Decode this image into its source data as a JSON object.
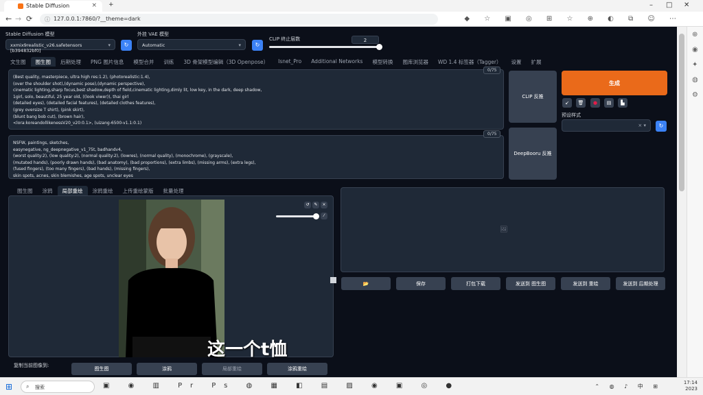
{
  "browser": {
    "tab_title": "Stable Diffusion",
    "new_tab": "+",
    "url": "127.0.0.1:7860/?__theme=dark",
    "back_icon": "←",
    "forward_icon": "→",
    "reload_icon": "⟳",
    "lock_icon": "ⓘ",
    "ext_icons": "◆ ☆ ▣ ◎ ⊞ ☆ ⊕ ◐ ⧉ ☺ ⋯",
    "tab_close": "×",
    "win_min": "–",
    "win_max": "□",
    "win_close": "✕",
    "chevron": "⌄"
  },
  "top": {
    "model_label": "Stable Diffusion 模型",
    "model_value": "xxmix9realistic_v26.safetensors [b394832bf0]",
    "vae_label": "外挂 VAE 模型",
    "vae_value": "Automatic",
    "clip_label": "CLIP 终止层数",
    "clip_value": "2",
    "clip_fraction": 1.0,
    "caret": "▾",
    "refresh_icon": "↻"
  },
  "main_tabs": [
    "文生图",
    "图生图",
    "后期处理",
    "PNG 图片信息",
    "模型合并",
    "训练",
    "3D 骨架模型编辑（3D Openpose）",
    "Isnet_Pro",
    "Additional Networks",
    "模型转换",
    "图库浏览器",
    "WD 1.4 标签器（Tagger）",
    "设置",
    "扩展"
  ],
  "main_active": 1,
  "prompt": {
    "counter": "0/75",
    "lines": [
      "(Best quality, masterpiece, ultra high res:1.2), (photorealistic:1.4),",
      "(over the shoulder shot),(dynamic pose),(dynamic perspective),",
      "cinematic lighting,sharp focus,best shadow,depth of field,cinematic lighting,dimly lit, low key, in the dark, deep shadow,",
      "1girl, solo, beautiful, 25 year old, ((look viwer)), thai girl",
      "(detailed eyes), (detailed facial features), (detailed clothes features),",
      "(grey oversize T shirt), (pink skirt),",
      "(blunt bang bob cut), (brown hair),",
      "<lora:koreandollikenessV20_v20:0.1>, (uizang-6500-v1.1:0.1)"
    ]
  },
  "negative": {
    "counter": "0/75",
    "lines": [
      "NSFW, paintings, sketches,",
      "easynegative, ng_deepnegative_v1_75t, badhandv4,",
      "(worst quality:2), (low quality:2), (normal quality:2), (lowres), (normal quality), (monochrome), (grayscale),",
      "(mutated hands), (poorly drawn hands), (bad anatomy), (bad proportions), (extra limbs), (missing arms), (extra legs),",
      "(fused fingers), (too many fingers), (bad hands), (missing fingers),",
      "skin spots, acnes, skin blemishes, age spots, unclear eyes"
    ]
  },
  "side_buttons": {
    "clip": "CLIP 反推",
    "deepbooru": "DeepBooru 反推",
    "generate": "生成",
    "preset_label": "预设样式",
    "small_icons": [
      "↙",
      "🗑",
      "●",
      "▤",
      "▙"
    ],
    "clear": "× ▾"
  },
  "sub_tabs": [
    "图生图",
    "涂鸦",
    "局部重绘",
    "涂鸦重绘",
    "上传重绘蒙版",
    "批量处理"
  ],
  "sub_active": 2,
  "image_tools": [
    "↺",
    "✎",
    "×"
  ],
  "brush_fraction": 0.95,
  "brush_icon": "⁄",
  "output_placeholder_icon": "🖼",
  "action_buttons": [
    "📂",
    "保存",
    "打包下载",
    "发送到 图生图",
    "发送到 重绘",
    "发送到 后期处理"
  ],
  "copy_label": "复制当前图像到:",
  "copy_buttons": [
    "图生图",
    "涂鸦",
    "局部重绘",
    "涂鸦重绘"
  ],
  "subtitle": "这一个t恤",
  "taskbar": {
    "start_icon": "⊞",
    "search_icon": "⌕",
    "search_placeholder": "搜索",
    "app_icons": "▣ ◉ ▥ Pr Ps ◍ ▦ ◧ ▤ ▨ ◉ ▣ ◎ ●",
    "tray_symbols": "⌃ ◍ ♪ 中 ⊞",
    "time": "17:14",
    "date": "2023"
  },
  "sidebar_icons": [
    "⊕",
    "◉",
    "✦",
    "◍",
    "⚙"
  ]
}
